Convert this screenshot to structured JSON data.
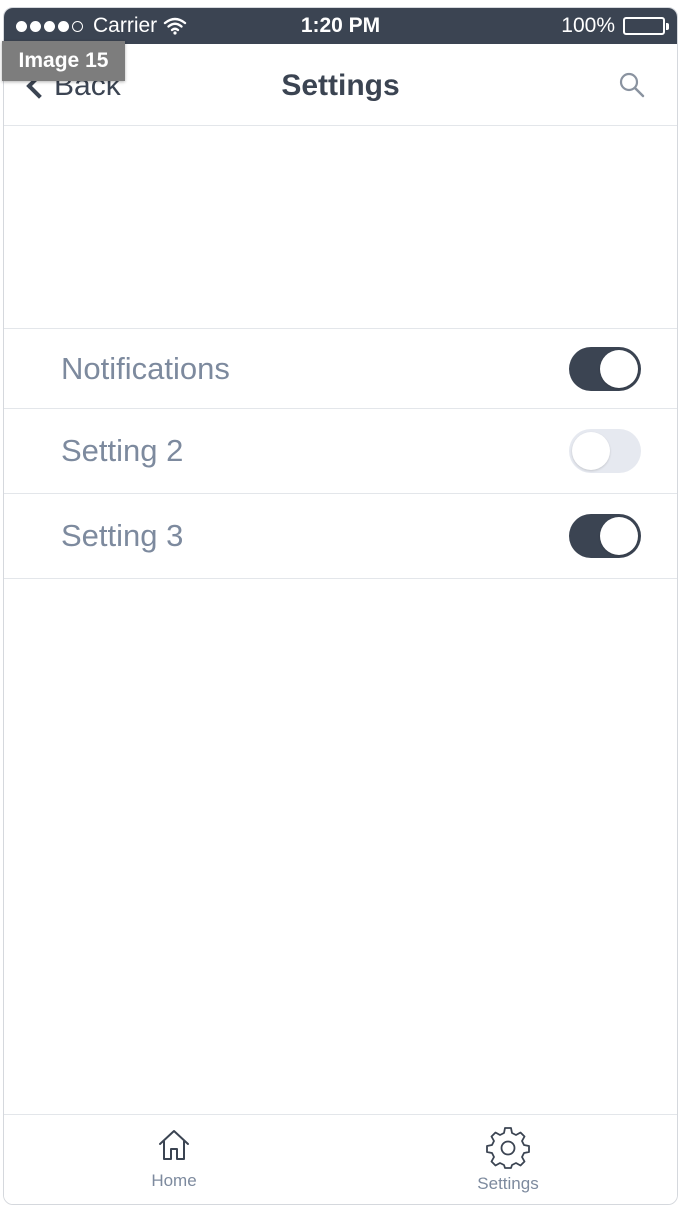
{
  "status_bar": {
    "signal_icon": "signal-dots-icon",
    "carrier": "Carrier",
    "wifi_icon": "wifi-icon",
    "time": "1:20 PM",
    "battery_percent": "100%",
    "battery_icon": "battery-icon",
    "battery_level": 1.0
  },
  "overlay": {
    "image_label": "Image 15"
  },
  "nav": {
    "back_label": "Back",
    "back_icon": "chevron-left-icon",
    "title": "Settings",
    "search_icon": "search-icon"
  },
  "settings": {
    "items": [
      {
        "label": "Notifications",
        "enabled": true
      },
      {
        "label": "Setting 2",
        "enabled": false
      },
      {
        "label": "Setting 3",
        "enabled": true
      }
    ]
  },
  "tab_bar": {
    "tabs": [
      {
        "label": "Home",
        "icon": "home-icon"
      },
      {
        "label": "Settings",
        "icon": "gear-icon"
      }
    ]
  },
  "colors": {
    "primary_dark": "#3b4452",
    "label_gray": "#7d8a9e",
    "toggle_off": "#e6e9f0",
    "divider": "#e3e6ea"
  }
}
